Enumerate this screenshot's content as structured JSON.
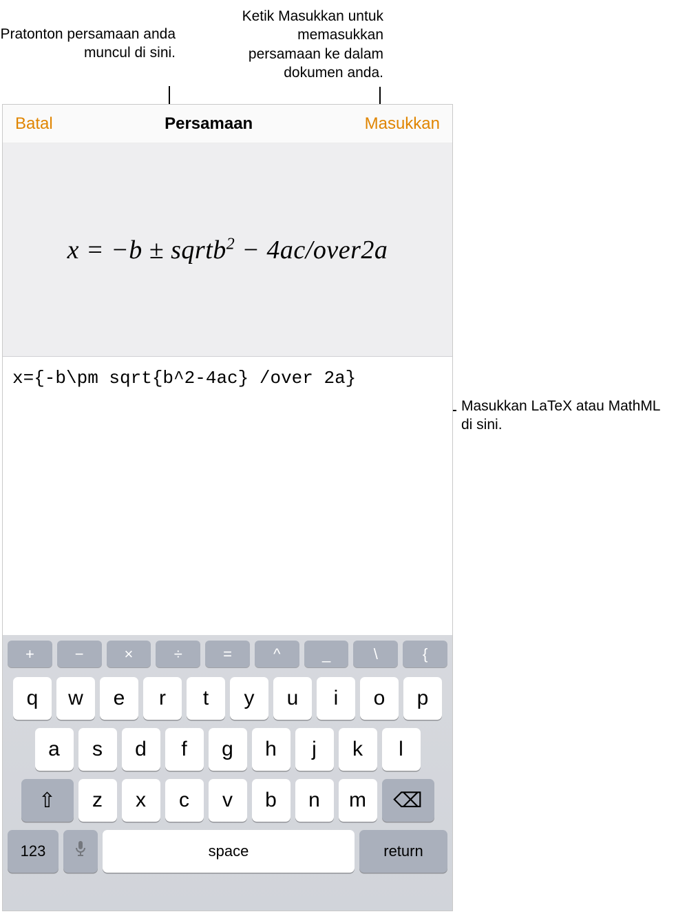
{
  "callouts": {
    "preview": "Pratonton persamaan anda muncul di sini.",
    "insert": "Ketik Masukkan untuk memasukkan persamaan ke dalam dokumen anda.",
    "input": "Masukkan LaTeX atau MathML di sini."
  },
  "topbar": {
    "cancel": "Batal",
    "title": "Persamaan",
    "insert": "Masukkan"
  },
  "equation": {
    "preview_html": "x = &minus;b &plusmn; sqrtb<sup>2</sup> &minus; 4ac/over2a",
    "source": "x={-b\\pm sqrt{b^2-4ac} /over 2a}"
  },
  "keyboard": {
    "symbol_row": [
      "+",
      "−",
      "×",
      "÷",
      "=",
      "^",
      "_",
      "\\",
      "{"
    ],
    "row1": [
      "q",
      "w",
      "e",
      "r",
      "t",
      "y",
      "u",
      "i",
      "o",
      "p"
    ],
    "row2": [
      "a",
      "s",
      "d",
      "f",
      "g",
      "h",
      "j",
      "k",
      "l"
    ],
    "row3": [
      "z",
      "x",
      "c",
      "v",
      "b",
      "n",
      "m"
    ],
    "shift": "⇧",
    "backspace": "⌫",
    "numbers": "123",
    "mic": "🎤",
    "space": "space",
    "return": "return"
  }
}
